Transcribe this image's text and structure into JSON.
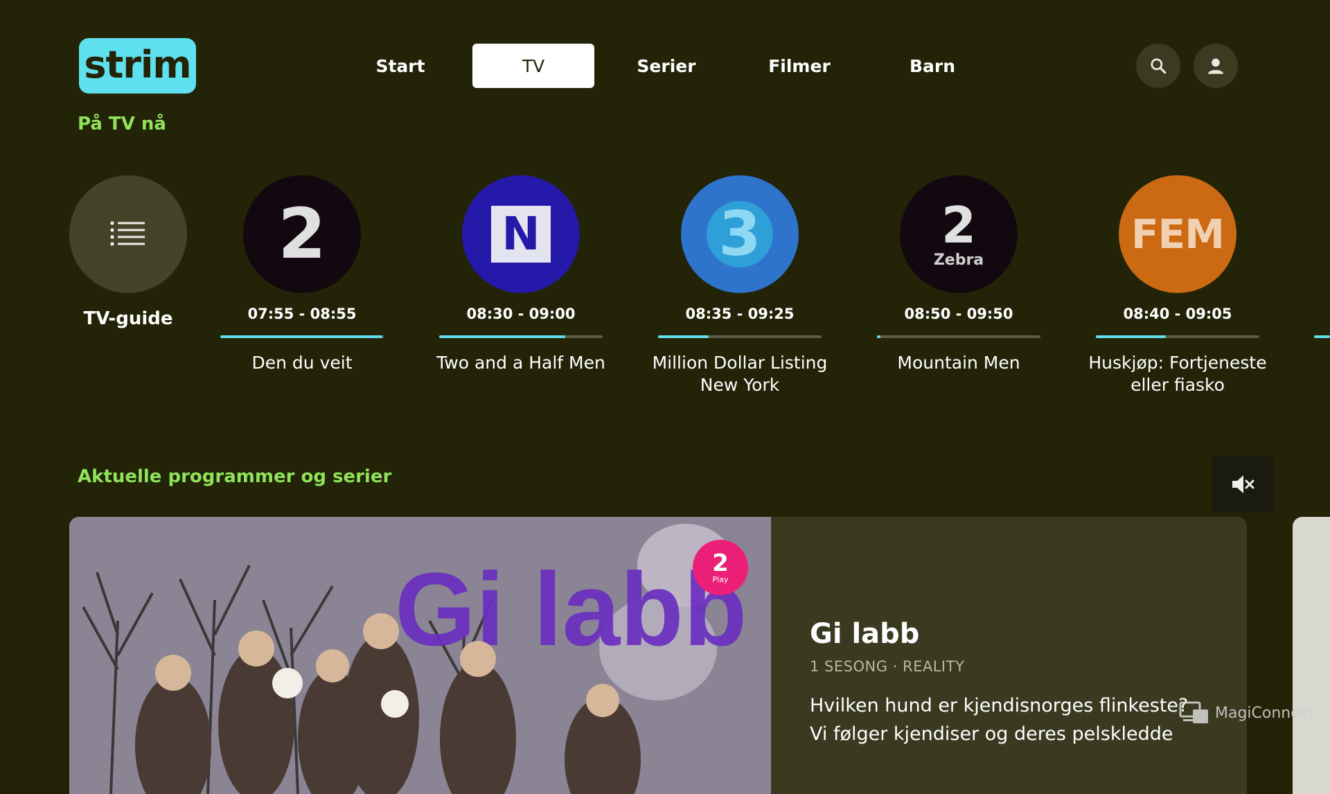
{
  "brand": {
    "logo_text": "strim",
    "accent": "#5ee0ee",
    "green": "#8fe35a",
    "background": "#232308"
  },
  "nav": {
    "items": [
      {
        "label": "Start",
        "active": false
      },
      {
        "label": "TV",
        "active": true
      },
      {
        "label": "Serier",
        "active": false
      },
      {
        "label": "Filmer",
        "active": false
      },
      {
        "label": "Barn",
        "active": false
      }
    ],
    "search_icon": "search-icon",
    "profile_icon": "user-icon"
  },
  "live": {
    "heading": "På TV nå",
    "guide": {
      "label": "TV-guide",
      "icon": "list-icon"
    },
    "channels": [
      {
        "logo": "2",
        "sublogo": "",
        "color": "#140810",
        "time": "07:55 - 08:55",
        "progress": 0.99,
        "title": "Den du veit"
      },
      {
        "logo": "N",
        "sublogo": "",
        "color": "#2419a8",
        "time": "08:30 - 09:00",
        "progress": 0.77,
        "title": "Two and a Half Men"
      },
      {
        "logo": "3",
        "sublogo": "",
        "color": "#2e73cc",
        "time": "08:35 - 09:25",
        "progress": 0.31,
        "title": "Million Dollar Listing New York"
      },
      {
        "logo": "2",
        "sublogo": "Zebra",
        "color": "#140810",
        "time": "08:50 - 09:50",
        "progress": 0.02,
        "title": "Mountain Men"
      },
      {
        "logo": "FEM",
        "sublogo": "",
        "color": "#cc6a14",
        "time": "08:40 - 09:05",
        "progress": 0.43,
        "title": "Huskjøp: Fortjeneste eller fiasko"
      }
    ]
  },
  "featured": {
    "heading": "Aktuelle programmer og serier",
    "mute_icon": "mute-icon",
    "title": "Gi labb",
    "meta": "1 SESONG · REALITY",
    "description": "Hvilken hund er kjendisnorges flinkeste? Vi følger kjendiser og deres pelskledde",
    "image_text": "Gi labb",
    "badge_logo": "2",
    "badge_text": "Play"
  },
  "watermark": {
    "text": "MagiConnect"
  }
}
